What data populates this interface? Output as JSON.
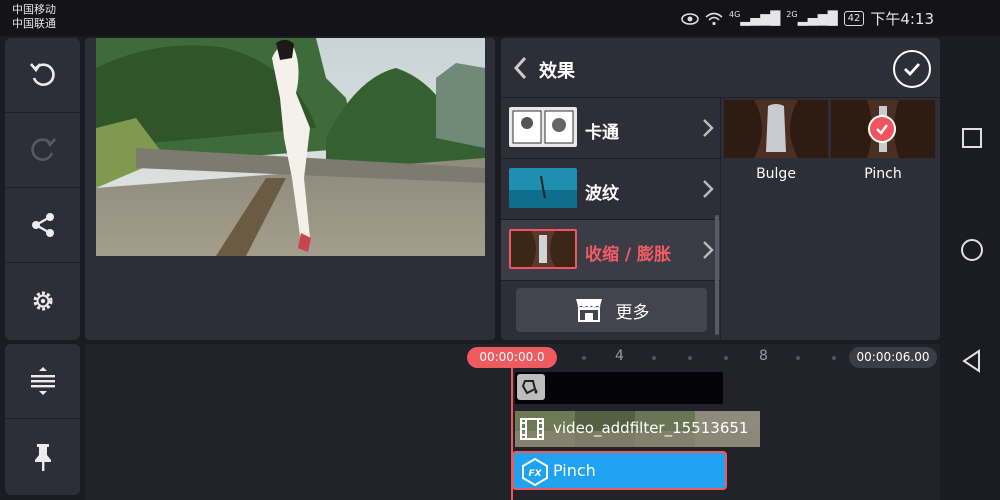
{
  "status_bar": {
    "carrier1": "中国移动",
    "carrier2": "中国联通",
    "net1": "4G",
    "net2": "2G",
    "battery": "42",
    "time": "下午4:13"
  },
  "left_toolbar": {
    "items": [
      {
        "name": "undo",
        "icon": "undo-icon",
        "enabled": true
      },
      {
        "name": "redo",
        "icon": "redo-icon",
        "enabled": false
      },
      {
        "name": "share",
        "icon": "share-icon",
        "enabled": true
      },
      {
        "name": "settings",
        "icon": "gear-icon",
        "enabled": true
      }
    ]
  },
  "left_toolbar_bottom": {
    "items": [
      {
        "name": "layers-adjust",
        "icon": "track-adjust-icon"
      },
      {
        "name": "pin",
        "icon": "pin-icon"
      }
    ]
  },
  "effects_panel": {
    "title": "效果",
    "categories": [
      {
        "label": "卡通",
        "active": false
      },
      {
        "label": "波纹",
        "active": false
      },
      {
        "label": "收缩 / 膨胀",
        "active": true
      }
    ],
    "more_label": "更多",
    "effects": [
      {
        "label": "Bulge",
        "selected": false
      },
      {
        "label": "Pinch",
        "selected": true
      }
    ]
  },
  "timeline": {
    "current_time": "00:00:00.0",
    "end_time": "00:00:06.00",
    "ticks": [
      "4",
      "8"
    ],
    "video_clip_name": "video_addfilter_15513651",
    "fx_clip_label": "Pinch"
  },
  "colors": {
    "accent_red": "#ef5a5f",
    "fx_track_blue": "#1fa2f0",
    "panel_bg": "#2e2e38"
  }
}
